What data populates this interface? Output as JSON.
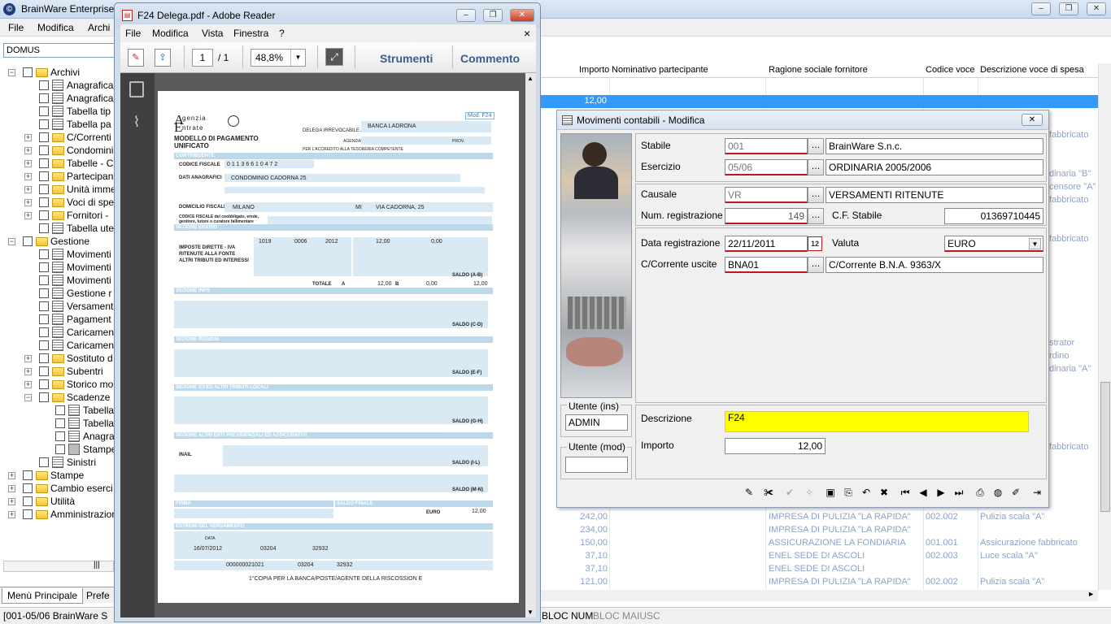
{
  "main_window": {
    "title": "BrainWare Enterprise",
    "app_icon": "©",
    "menu": [
      "File",
      "Modifica",
      "Archi"
    ],
    "win_buttons": [
      "–",
      "❐",
      "✕"
    ],
    "combo": "DOMUS",
    "tree": [
      {
        "label": "Archivi",
        "type": "folder",
        "expander": "−"
      },
      {
        "label": "Anagrafica",
        "type": "doc"
      },
      {
        "label": "Anagrafica",
        "type": "doc"
      },
      {
        "label": "Tabella tip",
        "type": "doc"
      },
      {
        "label": "Tabella pa",
        "type": "doc"
      },
      {
        "label": "C/Correnti",
        "type": "folder",
        "expander": "+"
      },
      {
        "label": "Condomini",
        "type": "folder",
        "expander": "+"
      },
      {
        "label": "Tabelle - C",
        "type": "folder",
        "expander": "+"
      },
      {
        "label": "Partecipan",
        "type": "folder",
        "expander": "+"
      },
      {
        "label": "Unità imme",
        "type": "folder",
        "expander": "+"
      },
      {
        "label": "Voci di spe",
        "type": "folder",
        "expander": "+"
      },
      {
        "label": "Fornitori -",
        "type": "folder",
        "expander": "+"
      },
      {
        "label": "Tabella ute",
        "type": "doc"
      },
      {
        "label": "Gestione",
        "type": "folder",
        "expander": "−"
      },
      {
        "label": "Movimenti",
        "type": "doc"
      },
      {
        "label": "Movimenti",
        "type": "doc"
      },
      {
        "label": "Movimenti",
        "type": "doc"
      },
      {
        "label": "Gestione r",
        "type": "doc"
      },
      {
        "label": "Versament",
        "type": "doc"
      },
      {
        "label": "Pagament",
        "type": "doc"
      },
      {
        "label": "Caricamen",
        "type": "doc"
      },
      {
        "label": "Caricamen",
        "type": "doc"
      },
      {
        "label": "Sostituto d",
        "type": "folder",
        "expander": "+"
      },
      {
        "label": "Subentri",
        "type": "folder",
        "expander": "+"
      },
      {
        "label": "Storico mo",
        "type": "folder",
        "expander": "+"
      },
      {
        "label": "Scadenze",
        "type": "folder",
        "expander": "−"
      },
      {
        "label": "Tabella",
        "type": "doc"
      },
      {
        "label": "Tabella",
        "type": "doc"
      },
      {
        "label": "Anagra",
        "type": "doc"
      },
      {
        "label": "Stampe",
        "type": "printer"
      },
      {
        "label": "Sinistri",
        "type": "doc"
      },
      {
        "label": "Stampe",
        "type": "folder",
        "expander": "+"
      },
      {
        "label": "Cambio eserci",
        "type": "folder",
        "expander": "+"
      },
      {
        "label": "Utilità",
        "type": "folder",
        "expander": "+"
      },
      {
        "label": "Amministrazion",
        "type": "folder",
        "expander": "+"
      }
    ],
    "tabs": [
      "Menù Principale",
      "Prefe"
    ],
    "status": {
      "left": "[001-05/06 BrainWare S",
      "num": "BLOC NUM",
      "caps": "BLOC MAIUSC"
    }
  },
  "grid": {
    "columns": [
      "Importo",
      "Nominativo partecipante",
      "Ragione sociale fornitore",
      "Codice voce",
      "Descrizione voce di spesa"
    ],
    "selected_importo": "12,00",
    "right_peek": [
      "fabbricato",
      "dinaria \"B\"",
      "censore \"A\"",
      "fabbricato",
      "fabbricato",
      "strator",
      "rdino",
      "dinaria \"A\"",
      "fabbricato"
    ],
    "rows": [
      {
        "importo": "242,00",
        "fornitore": "IMPRESA DI PULIZIA \"LA RAPIDA\"",
        "codice": "002.002",
        "descr": "Pulizia scala \"A\""
      },
      {
        "importo": "234,00",
        "fornitore": "IMPRESA DI PULIZIA \"LA RAPIDA\"",
        "codice": "",
        "descr": ""
      },
      {
        "importo": "150,00",
        "fornitore": "ASSICURAZIONE LA FONDIARIA",
        "codice": "001.001",
        "descr": "Assicurazione fabbricato"
      },
      {
        "importo": "37,10",
        "fornitore": "ENEL SEDE DI ASCOLI",
        "codice": "002.003",
        "descr": "Luce scala \"A\""
      },
      {
        "importo": "37,10",
        "fornitore": "ENEL SEDE DI ASCOLI",
        "codice": "",
        "descr": ""
      },
      {
        "importo": "121,00",
        "fornitore": "IMPRESA DI PULIZIA \"LA RAPIDA\"",
        "codice": "002.002",
        "descr": "Pulizia scala \"A\""
      }
    ]
  },
  "adobe": {
    "title": "F24 Delega.pdf - Adobe Reader",
    "menu": [
      "File",
      "Modifica",
      "Vista",
      "Finestra",
      "?"
    ],
    "close_doc": "×",
    "page_current": "1",
    "page_total": "/ 1",
    "zoom": "48,8%",
    "tools": "Strumenti",
    "comment": "Commento",
    "pdf": {
      "agency_line1": "genzia",
      "agency_line2": "ntrate",
      "agency_A": "A",
      "agency_E": "E",
      "mod": "Mod. F24",
      "title1": "MODELLO DI PAGAMENTO",
      "title2": "UNIFICATO",
      "delega": "DELEGA IRREVOCABILE A:",
      "bank": "BANCA LADRONA",
      "agenzia": "AGENZIA",
      "prov": "PROV.",
      "accredito": "PER L'ACCREDITO ALLA TESORERIA COMPETENTE",
      "sec_contribuente": "CONTRIBUENTE",
      "codice_fiscale_label": "CODICE FISCALE",
      "codice_fiscale": "0 1 1 3 6 6 1 0 4 7 2",
      "dati_anagrafici": "DATI ANAGRAFICI",
      "cognome": "CONDOMINIO CADORNA 25",
      "domicilio_label": "DOMICILIO FISCALE",
      "comune": "MILANO",
      "provincia": "MI",
      "via": "VIA CADORNA, 25",
      "codice_fiscale_coob": "CODICE FISCALE del coobbligato, erede, genitore, tutore o curatore fallimentare",
      "sec_erario": "SEZIONE ERARIO",
      "imposte1": "IMPOSTE DIRETTE - IVA",
      "imposte2": "RITENUTE ALLA FONTE",
      "imposte3": "ALTRI TRIBUTI ED INTERESSI",
      "codice_tributo": "1019",
      "rateazione": "0006",
      "anno": "2012",
      "importo_debito": "12,00",
      "importo_credito": "0,00",
      "saldo_ab_label": "SALDO (A-B)",
      "saldo_ab": "12,00",
      "totale_label": "TOTALE",
      "totale_a_letter": "A",
      "totale_a": "12,00",
      "totale_b_letter": "B",
      "totale_b": "0,00",
      "sec_inps": "SEZIONE INPS",
      "saldo_cd": "SALDO (C-D)",
      "sec_regioni": "SEZIONE REGIONI",
      "saldo_ef": "SALDO (E-F)",
      "sec_ici": "SEZIONE ICI ED ALTRI TRIBUTI LOCALI",
      "saldo_gh": "SALDO (G-H)",
      "sec_altri": "SEZIONE ALTRI ENTI PREVIDENZIALI ED ASSICURATIVI",
      "inail": "INAIL",
      "saldo_il": "SALDO (I-L)",
      "saldo_mn": "SALDO (M-N)",
      "firma": "FIRMA",
      "saldo_finale": "SALDO FINALE",
      "euro_label": "EURO",
      "euro": "12,00",
      "estremi": "ESTREMI DEL VERSAMENTO",
      "data_label": "DATA",
      "data": "16/07/2012",
      "abi": "03204",
      "cab": "32932",
      "conto": "000000021021",
      "abi2": "03204",
      "cab2": "32932",
      "copia": "1°COPIA PER LA BANCA/POSTE/AGENTE DELLA RISCOSSION E"
    }
  },
  "dialog": {
    "title": "Movimenti contabili - Modifica",
    "close": "✕",
    "labels": {
      "stabile": "Stabile",
      "esercizio": "Esercizio",
      "causale": "Causale",
      "num_reg": "Num. registrazione",
      "cf_stabile": "C.F. Stabile",
      "data_reg": "Data registrazione",
      "valuta": "Valuta",
      "cc_uscite": "C/Corrente uscite",
      "utente_ins": "Utente (ins)",
      "utente_mod": "Utente (mod)",
      "descrizione": "Descrizione",
      "importo": "Importo"
    },
    "values": {
      "stabile_code": "001",
      "stabile_name": "BrainWare S.n.c.",
      "esercizio_code": "05/06",
      "esercizio_name": "ORDINARIA 2005/2006",
      "causale_code": "VR",
      "causale_name": "VERSAMENTI RITENUTE",
      "num_reg": "149",
      "cf_stabile": "01369710445",
      "data_reg": "22/11/2011",
      "valuta": "EURO",
      "cc_code": "BNA01",
      "cc_name": "C/Corrente B.N.A. 9363/X",
      "utente_ins": "ADMIN",
      "utente_mod": "",
      "descrizione": "F24",
      "importo": "12,00"
    },
    "ellipsis": "…",
    "calendar": "12",
    "dropdown_arrow": "▼",
    "toolbar_icons": [
      "pencil-icon",
      "erase-icon",
      "confirm-icon",
      "clear-icon",
      "save-icon",
      "copy-icon",
      "undo-icon",
      "delete-icon",
      "first-icon",
      "prev-icon",
      "next-icon",
      "last-icon",
      "print-icon",
      "web-icon",
      "attach-icon",
      "exit-icon"
    ],
    "toolbar_glyphs": [
      "✎",
      "✀",
      "✔",
      "✧",
      "▣",
      "⎘",
      "↶",
      "✖",
      "⏮",
      "◀",
      "▶",
      "⏭",
      "⎙",
      "◍",
      "✐",
      "⇥"
    ],
    "accent": "#3399ff",
    "highlight": "#ffff00"
  }
}
